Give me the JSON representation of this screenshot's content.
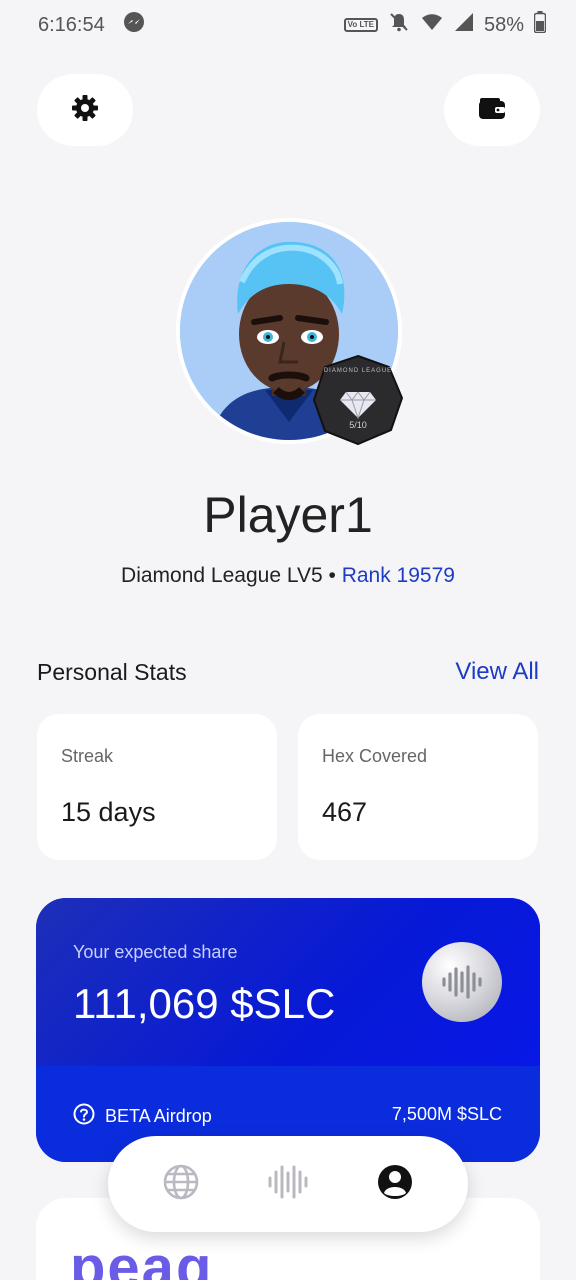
{
  "status_bar": {
    "time": "6:16:54",
    "volte": "Vo LTE",
    "battery": "58%"
  },
  "header": {
    "settings_icon": "gear-icon",
    "wallet_icon": "wallet-icon"
  },
  "profile": {
    "name": "Player1",
    "badge_title": "DIAMOND LEAGUE",
    "badge_progress": "5/10",
    "league": "Diamond League LV5",
    "separator": "•",
    "rank": "Rank 19579"
  },
  "personal_stats": {
    "title": "Personal Stats",
    "view_all": "View All",
    "cards": [
      {
        "label": "Streak",
        "value": "15 days"
      },
      {
        "label": "Hex Covered",
        "value": "467"
      }
    ]
  },
  "share_card": {
    "label": "Your expected share",
    "value": "111,069 $SLC",
    "airdrop_label": "BETA Airdrop",
    "airdrop_amount": "7,500M $SLC",
    "colors": {
      "card": "#0a24d8",
      "accent": "#1d3bc6"
    }
  },
  "partner": {
    "logo_text": "peaq"
  },
  "tab_bar": {
    "tabs": [
      {
        "icon": "globe-icon",
        "active": false
      },
      {
        "icon": "soundwave-icon",
        "active": false
      },
      {
        "icon": "profile-icon",
        "active": true
      }
    ]
  }
}
